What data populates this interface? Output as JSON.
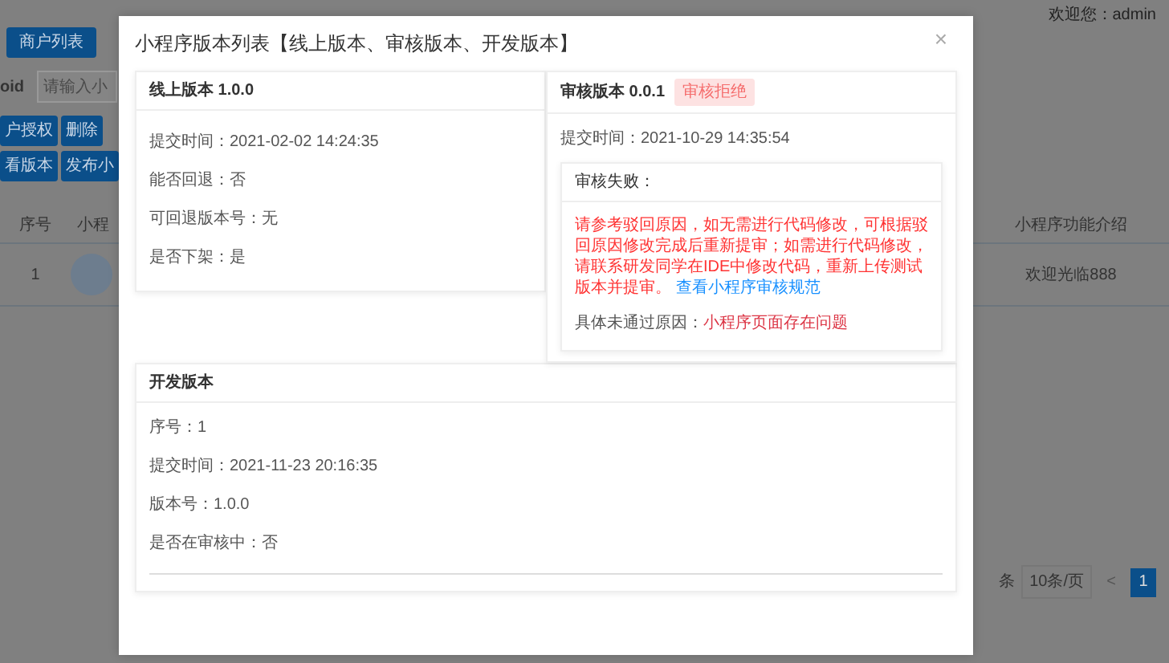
{
  "background_page": {
    "user_greeting": "欢迎您：admin",
    "tab": "商户列表",
    "search": {
      "label": "oid",
      "placeholder": "请输入小"
    },
    "buttons": [
      {
        "label": "户授权"
      },
      {
        "label": "删除"
      },
      {
        "label": "看版本"
      },
      {
        "label": "发布小"
      }
    ],
    "table": {
      "columns": [
        "序号",
        "小程",
        "小程序功能介绍"
      ],
      "rows": [
        {
          "index": "1",
          "intro": "欢迎光临888"
        }
      ]
    },
    "pagination": {
      "total_suffix": "条",
      "page_size": "10条/页",
      "prev": "<",
      "pages": [
        {
          "label": "1",
          "selected": true
        }
      ]
    }
  },
  "modal": {
    "title": "小程序版本列表【线上版本、审核版本、开发版本】",
    "close": "×",
    "online_version": {
      "title": "线上版本 1.0.0",
      "fields": [
        "提交时间：2021-02-02 14:24:35",
        "能否回退：否",
        "可回退版本号：无",
        "是否下架：是"
      ]
    },
    "audit_version": {
      "title": "审核版本 0.0.1",
      "status_tag": "审核拒绝",
      "submit_time": "提交时间：2021-10-29 14:35:54",
      "failure_box": {
        "title": "审核失败：",
        "message": "请参考驳回原因，如无需进行代码修改，可根据驳回原因修改完成后重新提审；如需进行代码修改，请联系研发同学在IDE中修改代码，重新上传测试版本并提审。",
        "link": "查看小程序审核规范",
        "reason_label": "具体未通过原因：",
        "reason": "小程序页面存在问题"
      }
    },
    "dev_version": {
      "title": "开发版本",
      "fields": [
        "序号：1",
        "提交时间：2021-11-23 20:16:35",
        "版本号：1.0.0",
        "是否在审核中：否"
      ]
    }
  }
}
